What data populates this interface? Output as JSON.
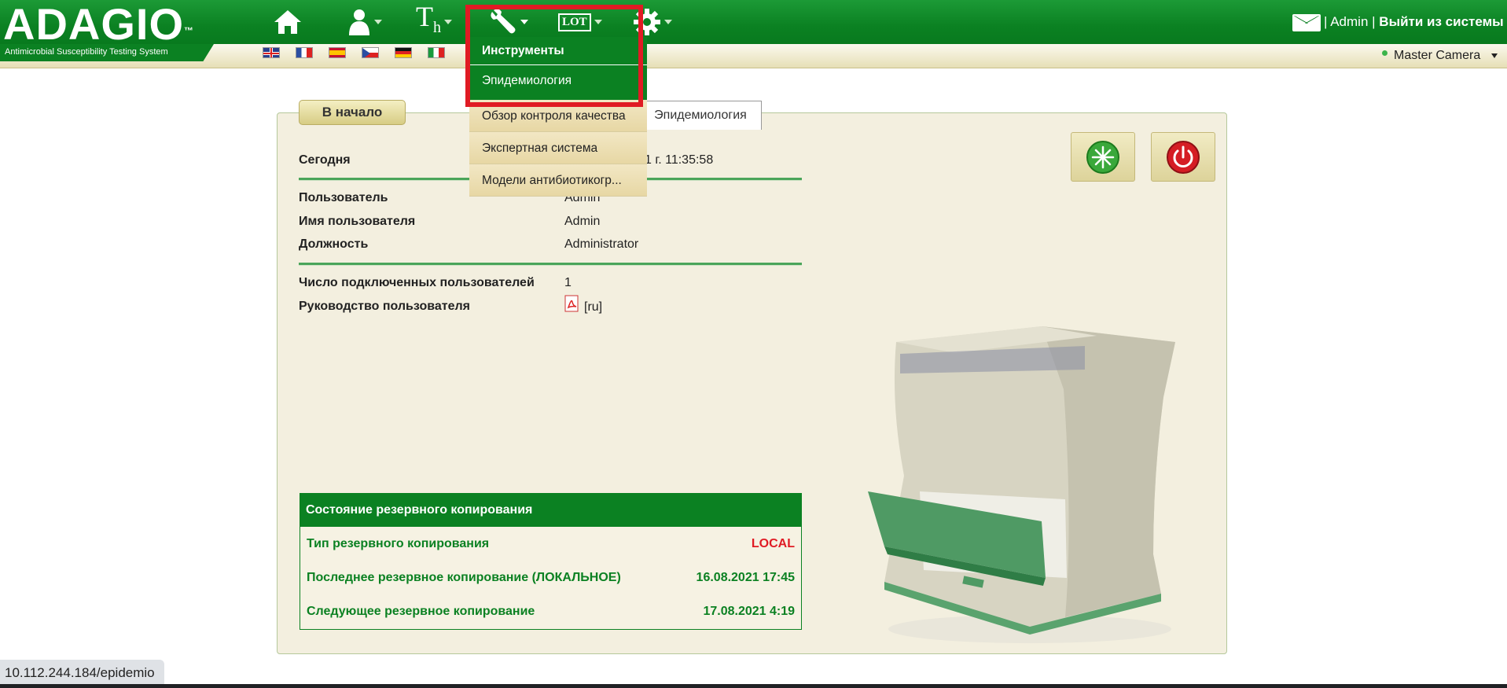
{
  "header": {
    "logo": "ADAGIO",
    "logo_tm": "™",
    "logo_subtitle": "Antimicrobial Susceptibility Testing System",
    "user_separator_1": "|",
    "user_name": "Admin",
    "user_separator_2": "|",
    "logout_label": "Выйти из системы",
    "camera_label": "Master Camera",
    "nav_icons": [
      "home-icon",
      "user-icon",
      "text-icon",
      "wrench-icon",
      "lot-icon",
      "gear-icon"
    ],
    "lot_text": "LOT",
    "th_text": "T",
    "th_sub": "h"
  },
  "languages": [
    "en",
    "fr",
    "es",
    "cz",
    "de",
    "it"
  ],
  "dropdown": {
    "header": "Инструменты",
    "items": [
      "Эпидемиология",
      "Обзор контроля качества",
      "Экспертная система",
      "Модели антибиотикогр..."
    ]
  },
  "tabs": {
    "home": "В начало",
    "active": "Эпидемиология"
  },
  "info": {
    "today_label": "Сегодня",
    "today_value": "1 г. 11:35:58",
    "user_label": "Пользователь",
    "user_value": "Admin",
    "username_label": "Имя пользователя",
    "username_value": "Admin",
    "role_label": "Должность",
    "role_value": "Administrator",
    "connected_label": "Число подключенных пользователей",
    "connected_value": "1",
    "manual_label": "Руководство пользователя",
    "manual_value": "[ru]"
  },
  "backup": {
    "title": "Состояние резервного копирования",
    "rows": [
      {
        "label": "Тип резервного копирования",
        "value": "LOCAL"
      },
      {
        "label": "Последнее резервное копирование (ЛОКАЛЬНОЕ)",
        "value": "16.08.2021 17:45"
      },
      {
        "label": "Следующее резервное копирование",
        "value": "17.08.2021 4:19"
      }
    ]
  },
  "status_bar": {
    "url": "10.112.244.184/epidemio"
  },
  "colors": {
    "brand_green": "#0b8122",
    "highlight_red": "#e01b24",
    "panel_bg": "#f3efdf"
  }
}
